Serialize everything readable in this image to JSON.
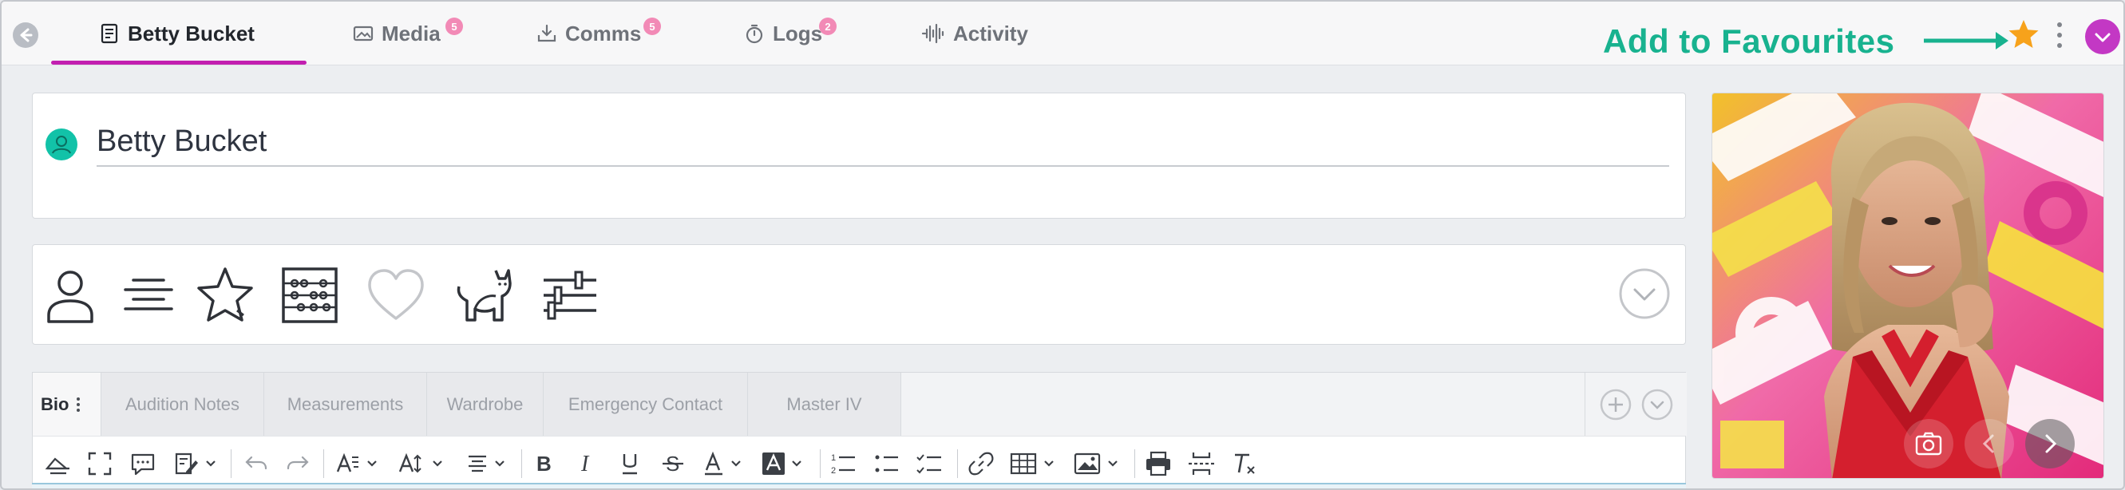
{
  "header": {
    "tabs": [
      {
        "label": "Betty Bucket",
        "icon": "document-icon",
        "active": true
      },
      {
        "label": "Media",
        "icon": "image-icon",
        "badge": "5"
      },
      {
        "label": "Comms",
        "icon": "inbox-download-icon",
        "badge": "5"
      },
      {
        "label": "Logs",
        "icon": "stopwatch-icon",
        "badge": "2"
      },
      {
        "label": "Activity",
        "icon": "waveform-icon"
      }
    ],
    "favourite_annotation": "Add to Favourites",
    "favourite_color": "#f7a21b",
    "accent_color": "#c21fb0"
  },
  "profile": {
    "name_value": "Betty Bucket"
  },
  "icon_strip": [
    "person-icon",
    "text-align-icon",
    "star-outline-icon",
    "abacus-icon",
    "heart-outline-icon",
    "cat-icon",
    "sliders-icon"
  ],
  "subtabs": [
    {
      "label": "Bio",
      "active": true
    },
    {
      "label": "Audition Notes"
    },
    {
      "label": "Measurements"
    },
    {
      "label": "Wardrobe"
    },
    {
      "label": "Emergency Contact"
    },
    {
      "label": "Master IV"
    }
  ],
  "toolbar_icons": [
    "paint-eraser-icon",
    "fullscreen-icon",
    "comment-icon",
    "edit-dropdown-icon",
    "undo-icon",
    "redo-icon",
    "text-style-icon",
    "font-size-icon",
    "align-icon",
    "bold-icon",
    "italic-icon",
    "underline-icon",
    "strikethrough-icon",
    "font-color-icon",
    "highlight-icon",
    "numbered-list-icon",
    "bullet-list-icon",
    "checklist-icon",
    "link-icon",
    "table-icon",
    "image-icon",
    "print-icon",
    "page-break-icon",
    "clear-format-icon"
  ],
  "photo": {
    "controls": [
      "camera-icon",
      "chevron-left-icon",
      "chevron-right-icon"
    ]
  }
}
